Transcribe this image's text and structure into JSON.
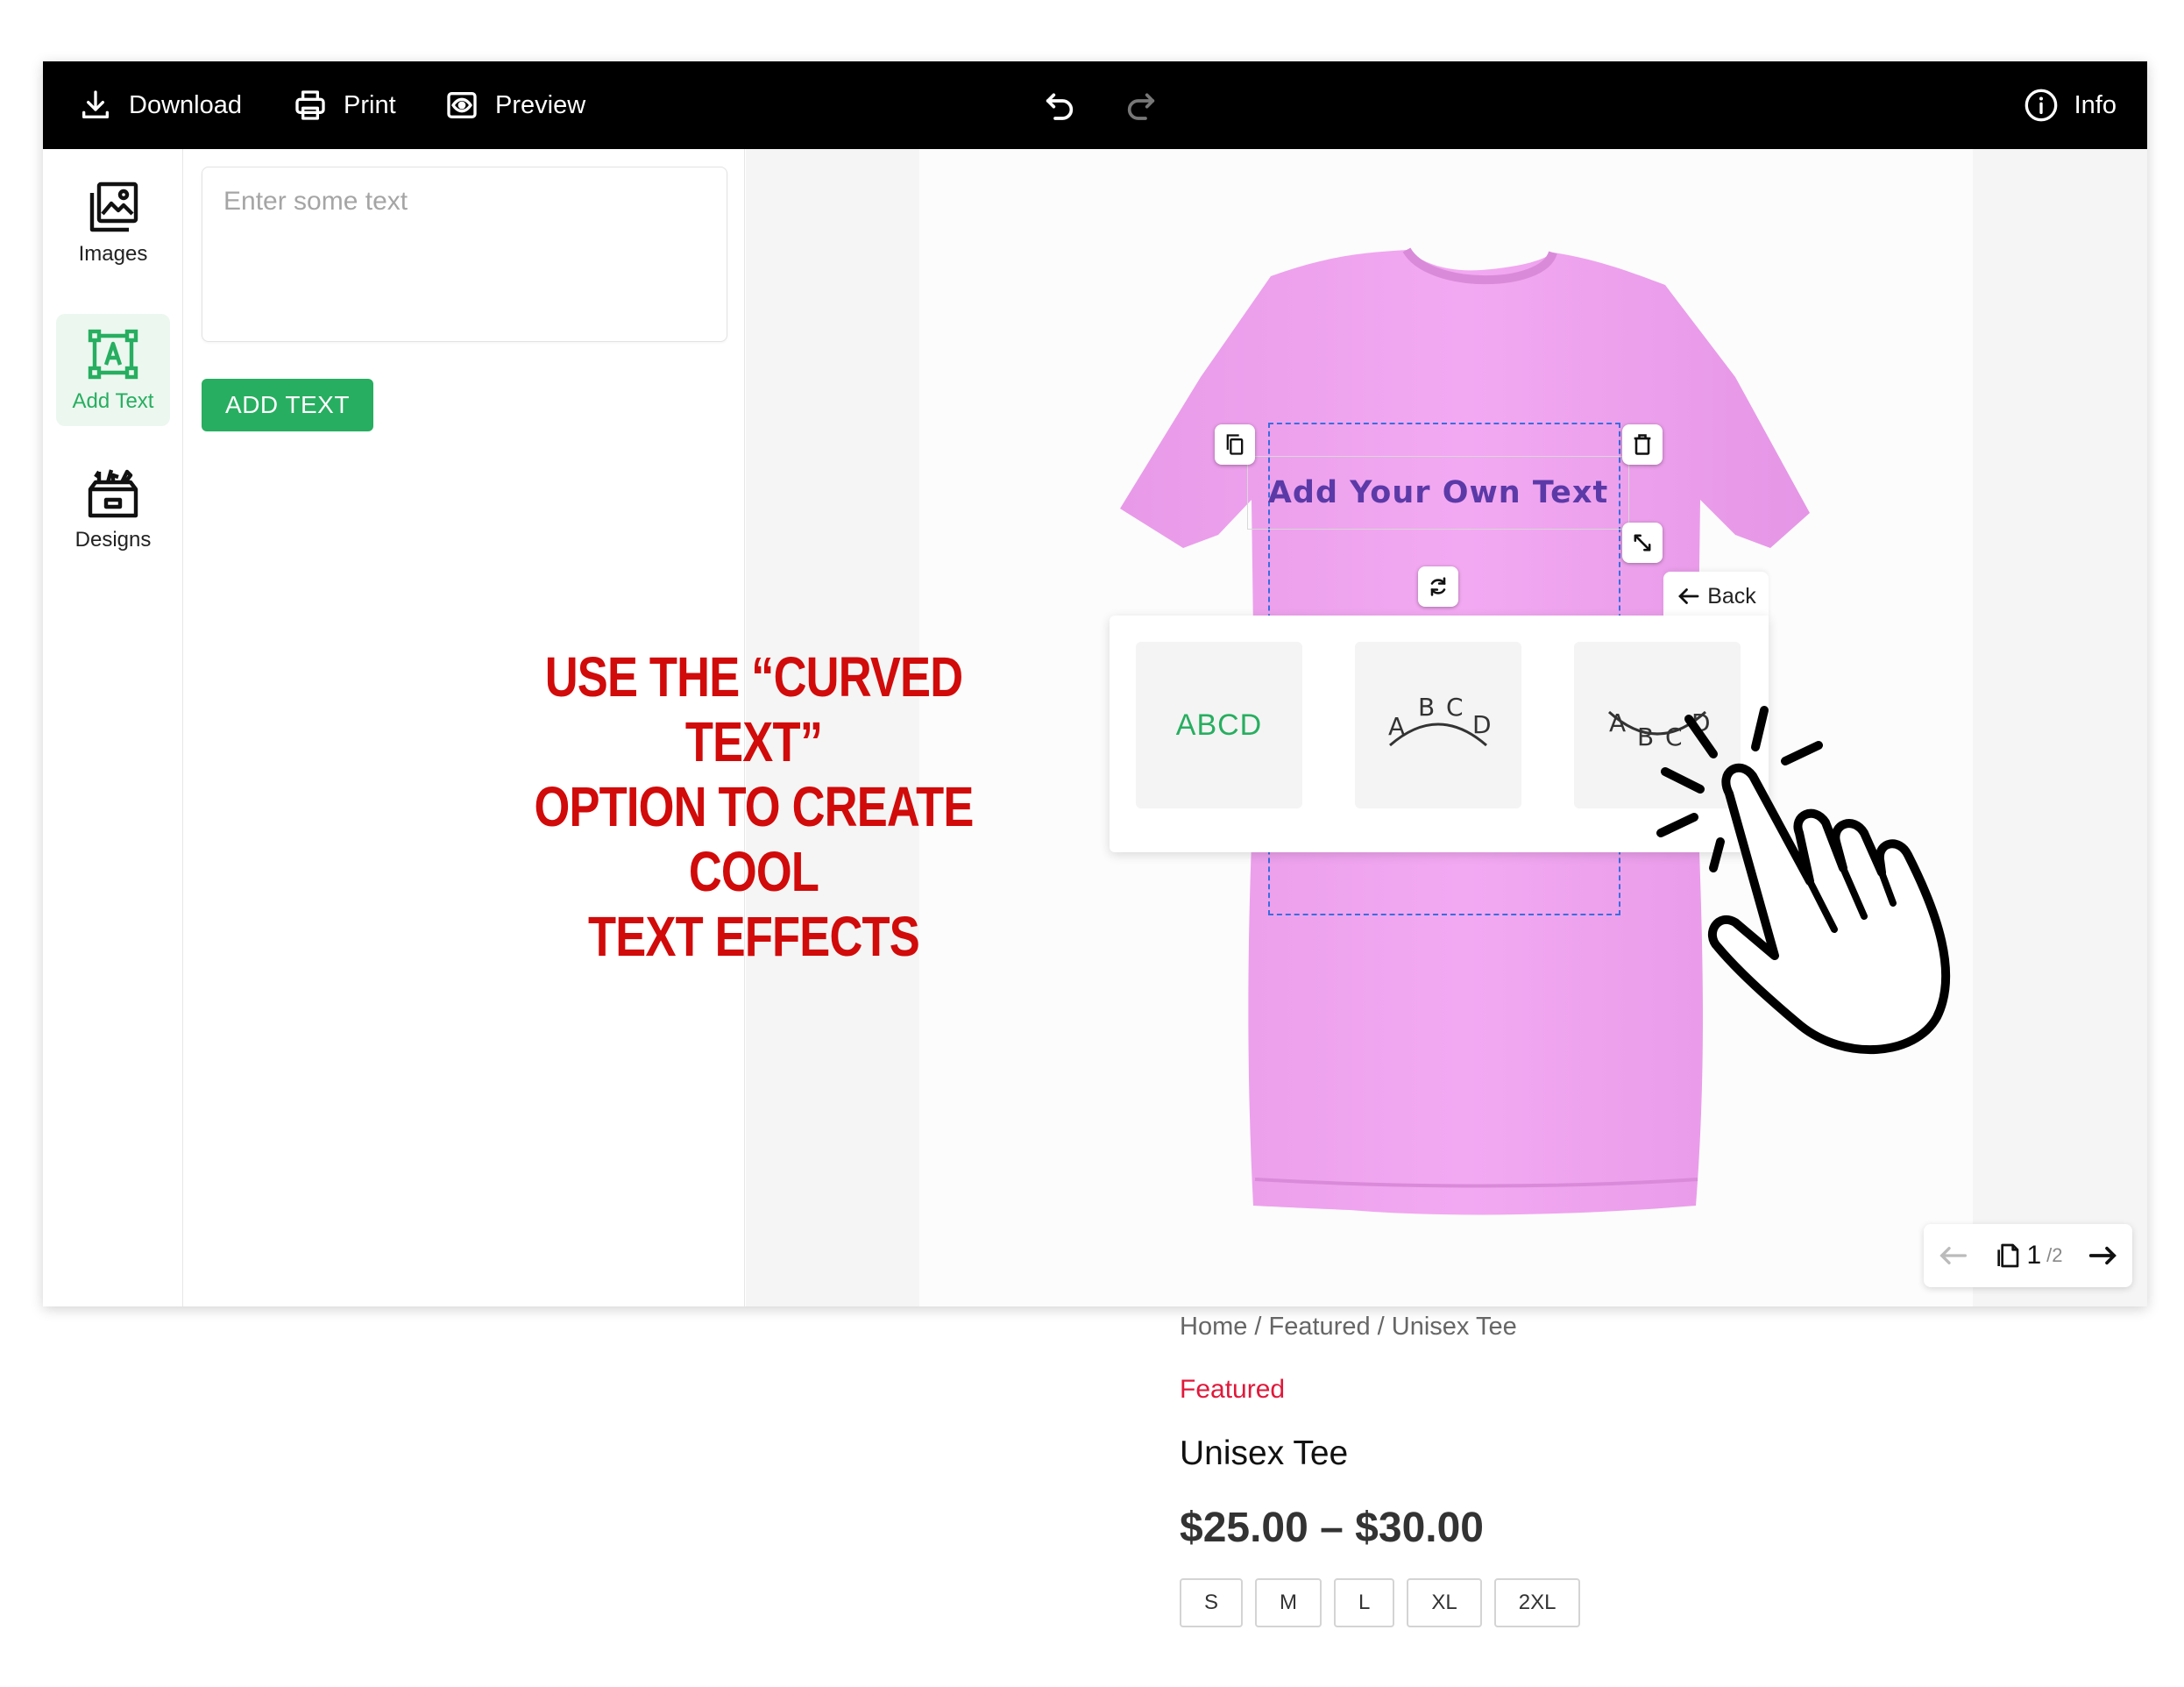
{
  "toolbar": {
    "download_label": "Download",
    "print_label": "Print",
    "preview_label": "Preview",
    "info_label": "Info"
  },
  "rail": {
    "items": [
      {
        "label": "Images",
        "icon": "images-icon"
      },
      {
        "label": "Add Text",
        "icon": "add-text-icon",
        "active": true
      },
      {
        "label": "Designs",
        "icon": "designs-icon"
      }
    ]
  },
  "panel": {
    "text_placeholder": "Enter some text",
    "text_value": "",
    "add_text_button": "ADD TEXT"
  },
  "canvas": {
    "shirt_color": "#f4a6f7",
    "text_object": "Add Your Own Text",
    "text_color": "#5b3aa8",
    "selection_color": "#3a6de0"
  },
  "curve_popup": {
    "back_label": "Back",
    "options": [
      {
        "label": "ABCD",
        "style": "straight"
      },
      {
        "label": "ABCD",
        "style": "arc-up"
      },
      {
        "label": "ABCD",
        "style": "arc-down"
      }
    ]
  },
  "overlay": {
    "line1": "USE THE “CURVED TEXT”",
    "line2": "OPTION TO CREATE COOL",
    "line3": "TEXT EFFECTS",
    "color": "#d10a0a"
  },
  "pager": {
    "current": "1",
    "total": "/2"
  },
  "product": {
    "breadcrumb": [
      "Home",
      "Featured",
      "Unisex Tee"
    ],
    "breadcrumb_sep": " / ",
    "category": "Featured",
    "title": "Unisex Tee",
    "price": "$25.00 – $30.00",
    "sizes": [
      "S",
      "M",
      "L",
      "XL",
      "2XL"
    ]
  },
  "colors": {
    "accent": "#27ae60",
    "category": "#e0183a",
    "toolbar_bg": "#000000"
  }
}
